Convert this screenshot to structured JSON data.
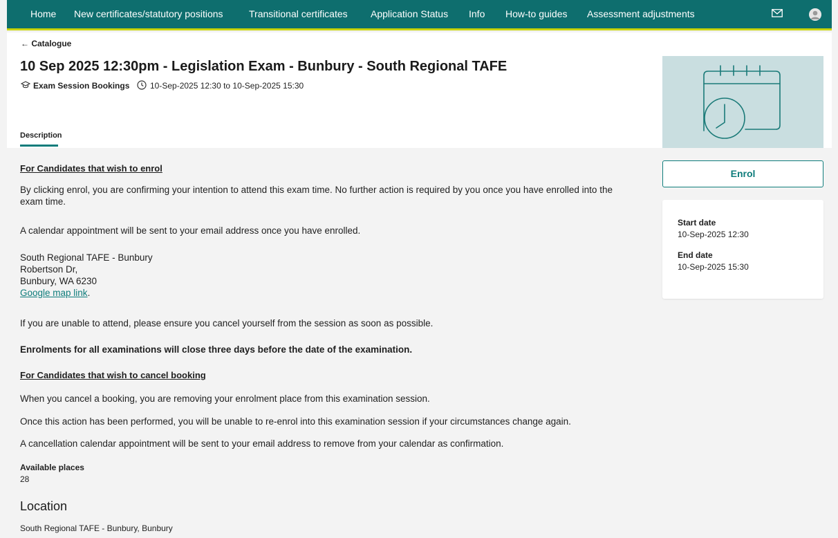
{
  "nav": {
    "items": [
      "Home",
      "New certificates/statutory positions",
      "Transitional certificates",
      "Application Status",
      "Info",
      "How-to guides",
      "Assessment adjustments"
    ],
    "mail_icon": "mail-icon",
    "avatar_icon": "avatar"
  },
  "header": {
    "back_label": "← Catalogue",
    "title": "10 Sep 2025 12:30pm - Legislation Exam - Bunbury - South Regional TAFE",
    "category": "Exam Session Bookings",
    "date_range": "10-Sep-2025 12:30 to 10-Sep-2025 15:30",
    "tab_label": "Description"
  },
  "description": {
    "enrol_heading": "For Candidates that wish to enrol",
    "enrol_p1_line1": "By clicking enrol, you are confirming your intention to attend this exam time. No further action is required by you once you have enrolled into the",
    "enrol_p1_line2": "exam time.",
    "enrol_p2": "A calendar appointment will be sent to your email address once you have enrolled.",
    "address_line1": "South Regional TAFE - Bunbury",
    "address_line2": "Robertson Dr,",
    "address_line3": "Bunbury, WA 6230",
    "map_link": "Google map link",
    "map_link_suffix": ".",
    "unable_attend": "If you are unable to attend, please ensure you cancel yourself from the session as soon as possible.",
    "close_notice": "Enrolments for all examinations will close three days before the date of the examination.",
    "cancel_heading": "For Candidates that wish to cancel booking",
    "cancel_p1": "When you cancel a booking, you are removing your enrolment place from this examination session.",
    "cancel_p2": "Once this action has been performed, you will be unable to re-enrol into this examination session if your circumstances change again.",
    "cancel_p3": "A cancellation calendar appointment will be sent to your email address to remove from your calendar as confirmation."
  },
  "places": {
    "label": "Available places",
    "value": "28"
  },
  "location": {
    "heading": "Location",
    "value": "South Regional TAFE - Bunbury, Bunbury"
  },
  "sidebar": {
    "enrol_label": "Enrol",
    "start_label": "Start date",
    "start_value": "10-Sep-2025 12:30",
    "end_label": "End date",
    "end_value": "10-Sep-2025 15:30"
  },
  "colors": {
    "nav_bg": "#0e6e6e",
    "nav_accent": "#c9d400",
    "teal": "#0e7c7b",
    "thumb_bg": "#c9dee0"
  }
}
